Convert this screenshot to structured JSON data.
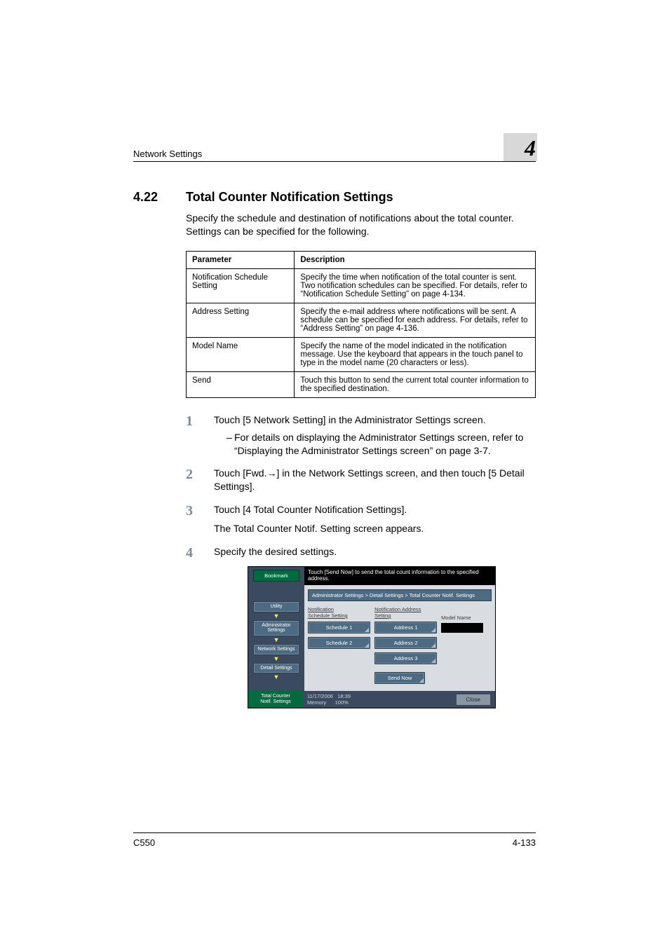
{
  "header": {
    "section": "Network Settings",
    "chapter_number": "4"
  },
  "h1": {
    "number": "4.22",
    "title": "Total Counter Notification Settings",
    "intro": "Specify the schedule and destination of notifications about the total counter. Settings can be specified for the following."
  },
  "table": {
    "head": {
      "c1": "Parameter",
      "c2": "Description"
    },
    "rows": [
      {
        "c1": "Notification Schedule Setting",
        "c2": "Specify the time when notification of the total counter is sent. Two notification schedules can be specified. For details, refer to “Notification Schedule Setting” on page 4-134."
      },
      {
        "c1": "Address Setting",
        "c2": "Specify the e-mail address where notifications will be sent. A schedule can be specified for each address. For details, refer to “Address Setting” on page 4-136."
      },
      {
        "c1": "Model Name",
        "c2": "Specify the name of the model indicated in the notification message. Use the keyboard that appears in the touch panel to type in the model name (20 characters or less)."
      },
      {
        "c1": "Send",
        "c2": "Touch this button to send the current total counter information to the specified destination."
      }
    ]
  },
  "steps": {
    "s1": {
      "n": "1",
      "text": "Touch [5 Network Setting] in the Administrator Settings screen.",
      "sub_dash": "–",
      "sub_text": "For details on displaying the Administrator Settings screen, refer to “Displaying the Administrator Settings screen” on page 3-7."
    },
    "s2": {
      "n": "2",
      "text_a": "Touch [Fwd.",
      "arrow": "→",
      "text_b": "] in the Network Settings screen, and then touch [5 Detail Settings]."
    },
    "s3": {
      "n": "3",
      "text": "Touch [4 Total Counter Notification Settings].",
      "text2": "The Total Counter Notif. Setting screen appears."
    },
    "s4": {
      "n": "4",
      "text": "Specify the desired settings."
    }
  },
  "screenshot": {
    "help": "Touch [Send Now] to send the total count information to the specified address.",
    "bookmark": "Bookmark",
    "crumbs": [
      "Utility",
      "Administrator Settings",
      "Network Settings",
      "Detail Settings"
    ],
    "current_crumb_l1": "Total Counter",
    "current_crumb_l2": "Notif. Settings",
    "breadcrumb": "Administrator Settings > Detail Settings > Total Counter Notif. Settings",
    "col1_hdr_l1": "Notification",
    "col1_hdr_l2": "Schedule Setting",
    "col2_hdr_l1": "Notification Address",
    "col2_hdr_l2": "Setting",
    "schedule1": "Schedule 1",
    "schedule2": "Schedule 2",
    "addr1": "Address 1",
    "addr2": "Address 2",
    "addr3": "Address 3",
    "model_label": "Model Name",
    "send_now": "Send Now",
    "date": "11/17/2006",
    "time": "18:39",
    "mem_label": "Memory",
    "mem_val": "100%",
    "close": "Close"
  },
  "footer": {
    "left": "C550",
    "right": "4-133"
  }
}
